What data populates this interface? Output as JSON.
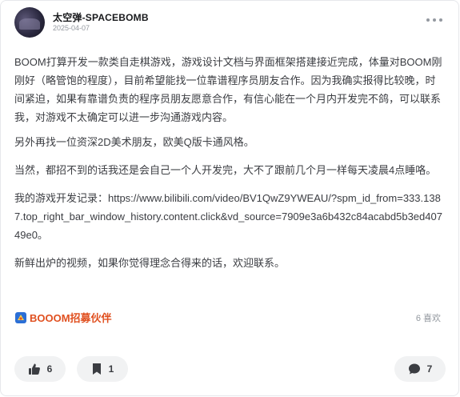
{
  "post": {
    "author": "太空弹-SPACEBOMB",
    "date": "2025-04-07",
    "paragraphs": [
      "BOOM打算开发一款类自走棋游戏，游戏设计文档与界面框架搭建接近完成，体量对BOOM刚刚好（略管饱的程度），目前希望能找一位靠谱程序员朋友合作。因为我确实报得比较晚，时间紧迫，如果有靠谱负责的程序员朋友愿意合作，有信心能在一个月内开发完不鸽，可以联系我，对游戏不太确定可以进一步沟通游戏内容。",
      "另外再找一位资深2D美术朋友，欧美Q版卡通风格。",
      "当然，都招不到的话我还是会自己一个人开发完，大不了跟前几个月一样每天凌晨4点睡咯。",
      "我的游戏开发记录：https://www.bilibili.com/video/BV1QwZ9YWEAU/?spm_id_from=333.1387.top_right_bar_window_history.content.click&vd_source=7909e3a6b432c84acabd5b3ed40749e0。",
      "新鲜出炉的视频，如果你觉得理念合得来的话，欢迎联系。"
    ],
    "topic_tag": "BOOOM招募伙伴",
    "likes_label": "6 喜欢"
  },
  "actions": {
    "like_count": "6",
    "favorite_count": "1",
    "comment_count": "7"
  },
  "icons": {
    "more": "more-dots-icon",
    "topic": "topic-badge-icon",
    "like": "thumbs-up-icon",
    "favorite": "bookmark-icon",
    "comment": "comment-bubble-icon"
  },
  "colors": {
    "topic": "#e05020",
    "muted": "#9499a0",
    "pill_bg": "#f1f2f3"
  }
}
